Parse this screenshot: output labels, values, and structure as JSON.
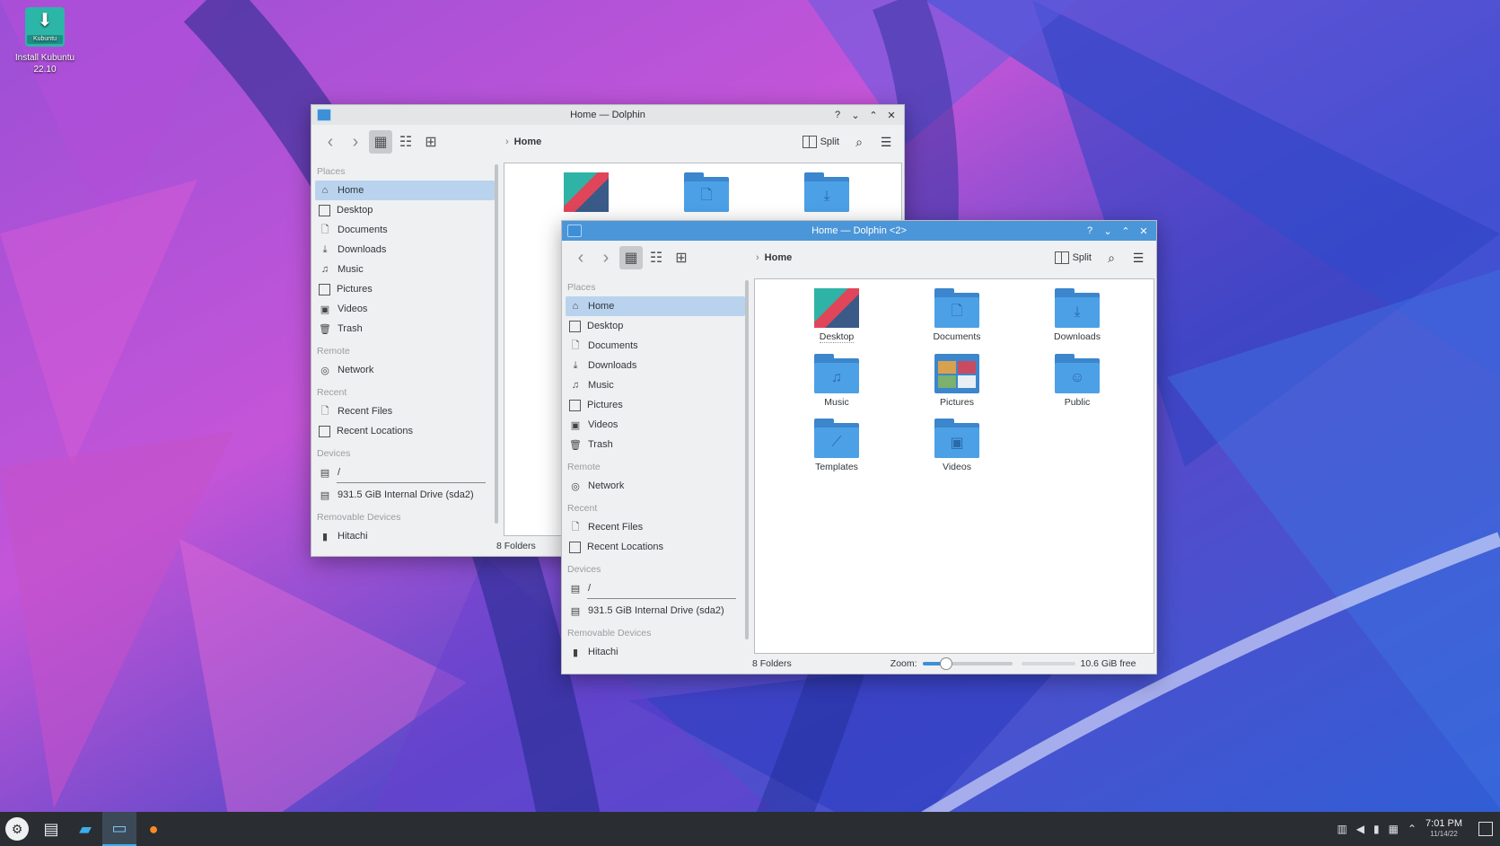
{
  "desktop": {
    "icon_line1": "Install Kubuntu",
    "icon_line2": "22.10",
    "icon_badge": "Kubuntu"
  },
  "windows": {
    "back": {
      "title": "Home — Dolphin",
      "breadcrumb": "Home",
      "split_label": "Split",
      "status_count": "8 Folders"
    },
    "front": {
      "title": "Home — Dolphin <2>",
      "breadcrumb": "Home",
      "split_label": "Split",
      "status_count": "8 Folders",
      "zoom_label": "Zoom:",
      "zoom_level": 0.25,
      "free_space": "10.6 GiB free"
    }
  },
  "titlebar_buttons": {
    "help": "?",
    "minimize": "⌄",
    "maximize": "⌃",
    "close": "✕"
  },
  "sidebar": {
    "places_header": "Places",
    "places": [
      "Home",
      "Desktop",
      "Documents",
      "Downloads",
      "Music",
      "Pictures",
      "Videos",
      "Trash"
    ],
    "remote_header": "Remote",
    "remote": [
      "Network"
    ],
    "recent_header": "Recent",
    "recent": [
      "Recent Files",
      "Recent Locations"
    ],
    "devices_header": "Devices",
    "devices": [
      "/",
      "931.5 GiB Internal Drive (sda2)"
    ],
    "removable_header": "Removable Devices",
    "removable": [
      "Hitachi"
    ]
  },
  "files": [
    "Desktop",
    "Documents",
    "Downloads",
    "Music",
    "Pictures",
    "Public",
    "Templates",
    "Videos"
  ],
  "taskbar": {
    "time": "7:01 PM",
    "date": "11/14/22"
  },
  "colors": {
    "accent": "#3d8fd8",
    "selection": "#b9d3ee",
    "active_titlebar": "#4b96d8",
    "taskbar": "#2a2e32"
  },
  "icons": {
    "back": "arrow-left-icon",
    "forward": "arrow-right-icon",
    "view_icons": "icons-view-icon",
    "view_compact": "compact-view-icon",
    "view_details": "details-view-icon",
    "search": "search-icon",
    "menu": "hamburger-menu-icon"
  }
}
